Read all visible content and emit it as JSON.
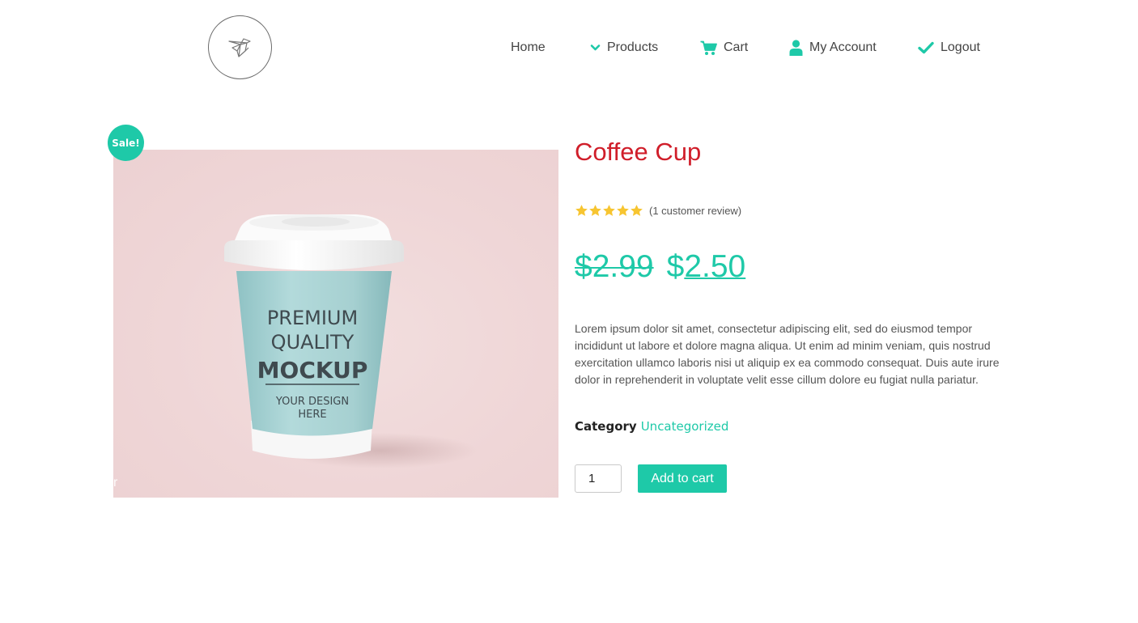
{
  "brand": {
    "logo_icon": "origami-bird-icon"
  },
  "nav": {
    "items": [
      {
        "label": "Home",
        "icon": ""
      },
      {
        "label": "Products",
        "icon": "chevron-down-icon"
      },
      {
        "label": "Cart",
        "icon": "cart-icon"
      },
      {
        "label": "My Account",
        "icon": "user-icon"
      },
      {
        "label": "Logout",
        "icon": "check-icon"
      }
    ]
  },
  "product": {
    "badge": "Sale!",
    "image": {
      "alt": "Coffee cup mockup",
      "cup_text": [
        "PREMIUM",
        "QUALITY",
        "MOCKUP",
        "YOUR DESIGN",
        "HERE"
      ],
      "corner_mark": "r"
    },
    "title": "Coffee Cup",
    "rating": {
      "stars": 5,
      "max": 5,
      "review_text": "(1 customer review)"
    },
    "price": {
      "old": "$2.99",
      "currency": "$",
      "new_amount": "2.50"
    },
    "description": "Lorem ipsum dolor sit amet, consectetur adipiscing elit, sed do eiusmod tempor incididunt ut labore et dolore magna aliqua. Ut enim ad minim veniam, quis nostrud exercitation ullamco laboris nisi ut aliquip ex ea commodo consequat. Duis aute irure dolor in reprehenderit in voluptate velit esse cillum dolore eu fugiat nulla pariatur.",
    "category": {
      "label": "Category",
      "value": "Uncategorized"
    },
    "quantity": "1",
    "add_to_cart_label": "Add to cart"
  },
  "colors": {
    "accent": "#1ec9a8",
    "title": "#d01e2a",
    "star": "#f7c531",
    "image_background": "#efd6d7",
    "cup_sleeve": "#a9d3d4"
  }
}
